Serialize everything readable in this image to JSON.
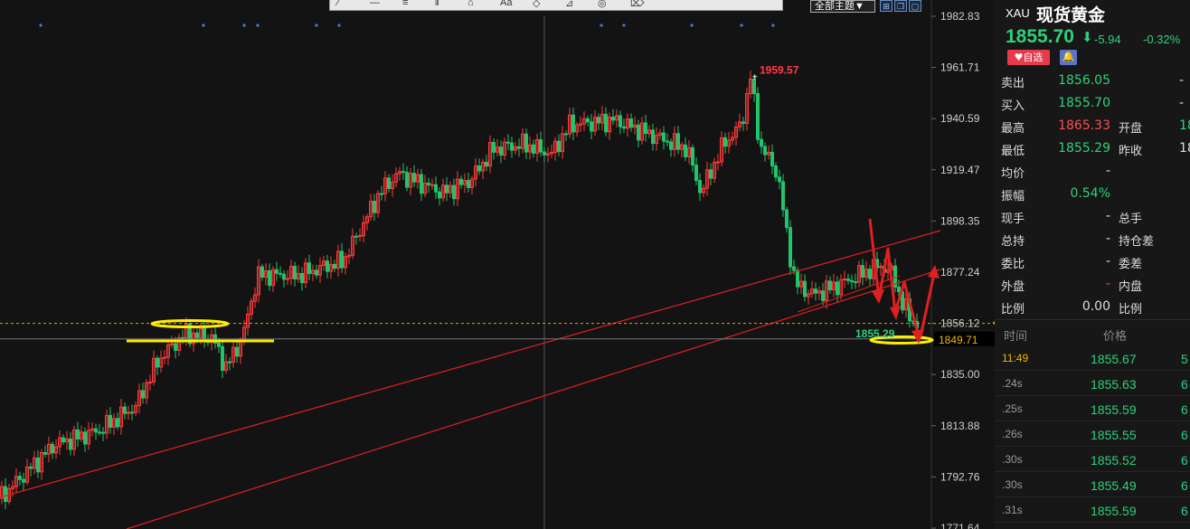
{
  "toolbar": {
    "theme_label": "全部主题▼",
    "icons": [
      "draw-line-icon",
      "hline-icon",
      "bars-icon",
      "fork-icon",
      "text-icon",
      "shape-icon",
      "fib-icon",
      "cycle-icon",
      "eraser-icon",
      "delete-icon"
    ]
  },
  "window_controls": [
    "layout-icon",
    "restore-icon",
    "maximize-icon"
  ],
  "y_axis": {
    "ticks": [
      "1982.83",
      "1961.71",
      "1940.59",
      "1919.47",
      "1898.35",
      "1877.24",
      "1856.12",
      "1835.00",
      "1813.88",
      "1792.76",
      "1771.64"
    ],
    "current_label": "1849.71"
  },
  "chart_data": {
    "type": "candlestick",
    "ylim": [
      1771.64,
      1982.83
    ],
    "high_label": "1959.57",
    "low_label": "1855.29",
    "last_price_line": 1856.12,
    "crosshair_price": 1849.71,
    "colors": {
      "up": "#ff3b3b",
      "down": "#21c36b",
      "trendline": "#e02020",
      "highlight": "#ffee00"
    }
  },
  "quote": {
    "symbol": "XAU",
    "name": "现货黄金",
    "price": "1855.70",
    "change": "-5.94",
    "change_pct": "-0.32%",
    "fav_label": "自选",
    "rows": [
      {
        "l1": "卖出",
        "v1": "1856.05",
        "c1": "#2fd07a",
        "l2": "",
        "v2": "-",
        "c2": "#ddd"
      },
      {
        "l1": "买入",
        "v1": "1855.70",
        "c1": "#2fd07a",
        "l2": "",
        "v2": "-",
        "c2": "#ddd"
      },
      {
        "l1": "最高",
        "v1": "1865.33",
        "c1": "#ff4d4d",
        "l2": "开盘",
        "v2": "18",
        "c2": "#2fd07a"
      },
      {
        "l1": "最低",
        "v1": "1855.29",
        "c1": "#2fd07a",
        "l2": "昨收",
        "v2": "18",
        "c2": "#ddd"
      },
      {
        "l1": "均价",
        "v1": "-",
        "c1": "#ddd",
        "l2": "",
        "v2": "",
        "c2": "#ddd"
      },
      {
        "l1": "振幅",
        "v1": "0.54%",
        "c1": "#2fd07a",
        "l2": "",
        "v2": "",
        "c2": "#ddd"
      },
      {
        "l1": "现手",
        "v1": "-",
        "c1": "#ddd",
        "l2": "总手",
        "v2": "",
        "c2": "#ddd"
      },
      {
        "l1": "总持",
        "v1": "-",
        "c1": "#ddd",
        "l2": "持仓差",
        "v2": "",
        "c2": "#ddd"
      },
      {
        "l1": "委比",
        "v1": "-",
        "c1": "#ddd",
        "l2": "委差",
        "v2": "",
        "c2": "#ddd"
      },
      {
        "l1": "外盘",
        "v1": "-",
        "c1": "#ff4d4d",
        "l2": "内盘",
        "v2": "",
        "c2": "#ddd"
      },
      {
        "l1": "比例",
        "v1": "0.00",
        "c1": "#ddd",
        "l2": "比例",
        "v2": "",
        "c2": "#ddd"
      }
    ]
  },
  "ticks_table": {
    "header_time": "时间",
    "header_price": "价格",
    "rows": [
      {
        "time": "11:49",
        "price": "1855.67",
        "vol": "5",
        "time_color": "#f0b400"
      },
      {
        "time": ".24s",
        "price": "1855.63",
        "vol": "6",
        "time_color": "#999"
      },
      {
        "time": ".25s",
        "price": "1855.59",
        "vol": "6",
        "time_color": "#999"
      },
      {
        "time": ".26s",
        "price": "1855.55",
        "vol": "6",
        "time_color": "#999"
      },
      {
        "time": ".30s",
        "price": "1855.52",
        "vol": "6",
        "time_color": "#999"
      },
      {
        "time": ".30s",
        "price": "1855.49",
        "vol": "6",
        "time_color": "#999"
      },
      {
        "time": ".31s",
        "price": "1855.59",
        "vol": "6",
        "time_color": "#999"
      }
    ]
  }
}
